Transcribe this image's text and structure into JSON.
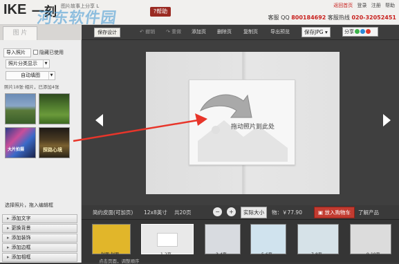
{
  "header": {
    "logo_text": "IKE",
    "logo_dash": "一刻",
    "tagline": "图片故事上分享 L",
    "help_label": "?帮助",
    "watermark": "河东软件园",
    "links": [
      "返回首页",
      "登录",
      "注册",
      "帮助"
    ],
    "contact": {
      "qq_label": "客服 QQ",
      "qq": "800184692",
      "hotline_label": "客服热线",
      "hotline": "020-32052451"
    }
  },
  "sidebar": {
    "tab_label": "图 片",
    "import_label": "导入照片",
    "hide_used_label": "隐藏已使用",
    "category_label": "照片分类显示",
    "auto_fill_label": "自动填图",
    "photo_count": "照片18张·相片，已添加4张",
    "thumbs": [
      {
        "label": ""
      },
      {
        "label": ""
      },
      {
        "label": "大片拍摄"
      },
      {
        "label": "探路心境"
      }
    ],
    "select_hint": "选择照片，拖入编辑框",
    "actions": [
      "添加文字",
      "更换背景",
      "添加装饰",
      "添加边框",
      "添加相框"
    ]
  },
  "toolbar": {
    "save_design": "保存设计",
    "undo": "撤销",
    "redo": "重做",
    "add_page": "添加页",
    "delete_page": "删除页",
    "copy_page": "复制页",
    "export_preview": "导出预览",
    "save_jpg": "保存JPG",
    "share": "分享"
  },
  "canvas": {
    "drop_text": "拖动照片到此处"
  },
  "info": {
    "left_label": "简约皮面(可加页)",
    "size": "12x8英寸",
    "pages": "共20页",
    "actual_size": "实际大小",
    "price": "物：￥77.90",
    "add_cart": "放入购物车",
    "learn_more": "了解产品"
  },
  "filmstrip": {
    "pages": [
      "封面-封面",
      "1-2页",
      "3-4页",
      "5-6页",
      "7-8页",
      "9-10页"
    ],
    "hint": "点击页面，调整顺序"
  },
  "colors": {
    "accent_red": "#c8201d",
    "toolbar_bg": "#3d3d3d",
    "canvas_bg": "#3f3f3f",
    "arrow_red": "#e8352a"
  }
}
